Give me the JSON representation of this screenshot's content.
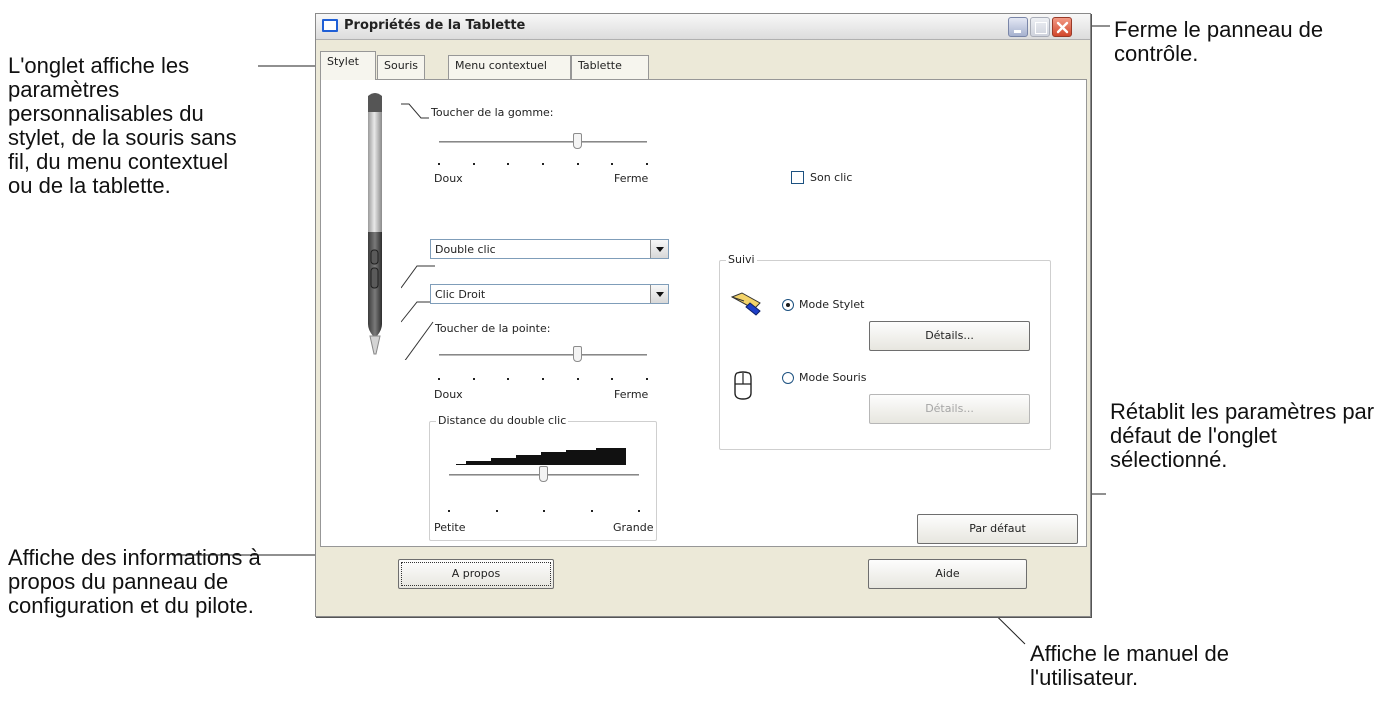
{
  "callouts": {
    "tab_info": "L'onglet affiche les paramètres personnalisables du stylet, de la souris sans fil, du menu contextuel ou de la tablette.",
    "close_info": "Ferme le panneau de contrôle.",
    "default_info": "Rétablit les paramètres par défaut de l'onglet sélectionné.",
    "about_info": "Affiche des informations à propos du panneau de configuration et du pilote.",
    "help_info": "Affiche le manuel de l'utilisateur."
  },
  "window": {
    "title": "Propriétés de la Tablette",
    "tabs": [
      "Stylet",
      "Souris",
      "Menu contextuel",
      "Tablette"
    ],
    "active_tab": "Stylet"
  },
  "pen": {
    "eraser_feel_label": "Toucher de la gomme:",
    "eraser_soft": "Doux",
    "eraser_firm": "Ferme",
    "eraser_level_percent": 67,
    "upper_button_value": "Double clic",
    "lower_button_value": "Clic Droit",
    "tip_feel_label": "Toucher de la pointe:",
    "tip_soft": "Doux",
    "tip_firm": "Ferme",
    "tip_level_percent": 67,
    "double_click_group": "Distance du double clic",
    "distance_small": "Petite",
    "distance_large": "Grande",
    "distance_level_percent": 50,
    "click_sound_label": "Son clic",
    "click_sound_checked": false
  },
  "tracking": {
    "group_title": "Suivi",
    "pen_mode_label": "Mode Stylet",
    "pen_mode_selected": true,
    "pen_details_label": "Détails...",
    "mouse_mode_label": "Mode Souris",
    "mouse_mode_selected": false,
    "mouse_details_label": "Détails..."
  },
  "buttons": {
    "default_label": "Par défaut",
    "about_label": "A propos",
    "help_label": "Aide"
  }
}
